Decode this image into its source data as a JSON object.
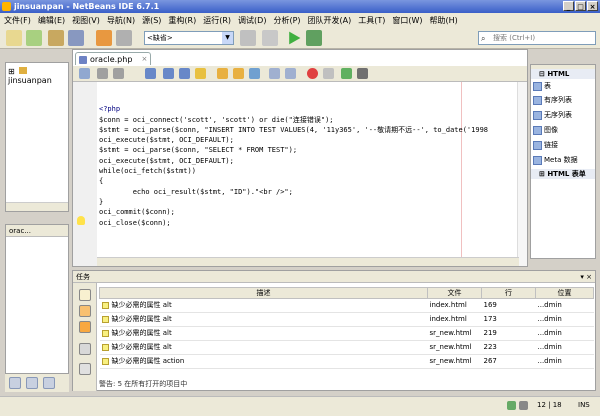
{
  "window": {
    "title": "jinsuanpan - NetBeans IDE 6.7.1",
    "controls": [
      "_",
      "□",
      "×"
    ]
  },
  "menu": [
    "文件(F)",
    "编辑(E)",
    "视图(V)",
    "导航(N)",
    "源(S)",
    "重构(R)",
    "运行(R)",
    "调试(D)",
    "分析(P)",
    "团队开发(A)",
    "工具(T)",
    "窗口(W)",
    "帮助(H)"
  ],
  "toolbar": {
    "config_value": "<缺省>",
    "search_placeholder": "搜索 (Ctrl+I)"
  },
  "projects": {
    "root_label": "jinsuanpan"
  },
  "navigator": {
    "tab_label": "orac..."
  },
  "editor": {
    "tab_label": "oracle.php",
    "lines": [
      "<?php",
      "$conn = oci_connect('scott', 'scott') or die(\"连接错误\");",
      "$stmt = oci_parse($conn, \"INSERT INTO TEST VALUES(4, '11y365', '--敬请期不远--', to_date('1998",
      "oci_execute($stmt, OCI_DEFAULT);",
      "$stmt = oci_parse($conn, \"SELECT * FROM TEST\");",
      "oci_execute($stmt, OCI_DEFAULT);",
      "while(oci_fetch($stmt))",
      "{",
      "        echo oci_result($stmt, \"ID\").\"<br />\";",
      "}",
      "oci_commit($conn);",
      "oci_close($conn);"
    ]
  },
  "palette": {
    "section_html": "HTML",
    "items": [
      "表",
      "有序列表",
      "无序列表",
      "图像",
      "链接",
      "Meta 数据"
    ],
    "section_forms": "HTML 表单"
  },
  "tasks": {
    "panel_label": "任务",
    "columns": [
      "描述",
      "文件",
      "行",
      "位置"
    ],
    "rows": [
      {
        "desc": "缺少必需的属性 alt",
        "file": "index.html",
        "line": "169",
        "loc": "...dmin"
      },
      {
        "desc": "缺少必需的属性 alt",
        "file": "index.html",
        "line": "173",
        "loc": "...dmin"
      },
      {
        "desc": "缺少必需的属性 alt",
        "file": "sr_new.html",
        "line": "219",
        "loc": "...dmin"
      },
      {
        "desc": "缺少必需的属性 alt",
        "file": "sr_new.html",
        "line": "223",
        "loc": "...dmin"
      },
      {
        "desc": "缺少必需的属性 action",
        "file": "sr_new.html",
        "line": "267",
        "loc": "...dmin"
      }
    ],
    "status": "警告: 5 在所有打开的项目中"
  },
  "statusbar": {
    "position": "12 | 18",
    "mode": "INS"
  }
}
